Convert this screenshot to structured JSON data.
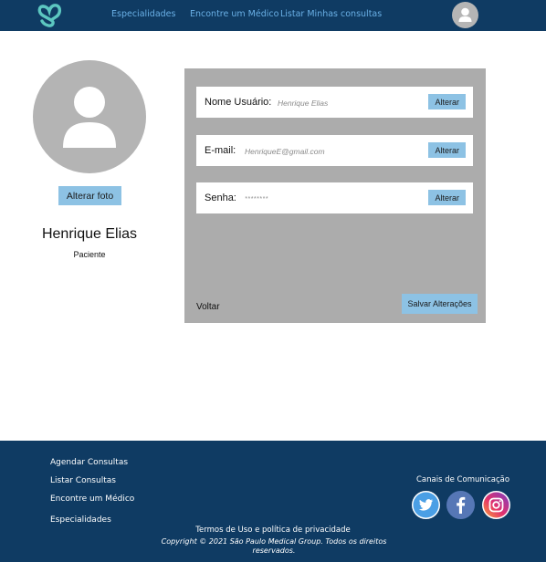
{
  "header": {
    "nav": [
      "Especialidades",
      "Encontre um Médico",
      "Listar Minhas consultas"
    ],
    "logo_icon": "heart-s-logo-icon",
    "avatar_icon": "user-avatar-icon"
  },
  "profile": {
    "change_photo": "Alterar foto",
    "name": "Henrique Elias",
    "role": "Paciente"
  },
  "form": {
    "fields": [
      {
        "label": "Nome Usuário:",
        "value": "Henrique Elias",
        "button": "Alterar"
      },
      {
        "label": "E-mail:",
        "value": "HenriqueE@gmail.com",
        "button": "Alterar"
      },
      {
        "label": "Senha:",
        "value": "********",
        "button": "Alterar"
      }
    ],
    "back": "Voltar",
    "save": "Salvar Alterações"
  },
  "footer": {
    "links": [
      "Agendar Consultas",
      "Listar Consultas",
      "Encontre um Médico",
      "Especialidades"
    ],
    "channels_title": "Canais de Comunicação",
    "social_icons": [
      "twitter-icon",
      "facebook-icon",
      "instagram-icon"
    ],
    "terms": "Termos de Uso e política de privacidade",
    "copyright": "Copyright © 2021 São Paulo Medical Group. Todos os direitos reservados."
  },
  "colors": {
    "header_bg": "#0f3b63",
    "nav_link": "#6ab0e6",
    "button_bg": "#8dc2e4",
    "panel_bg": "#acacac",
    "logo": "#5cc7c0"
  }
}
